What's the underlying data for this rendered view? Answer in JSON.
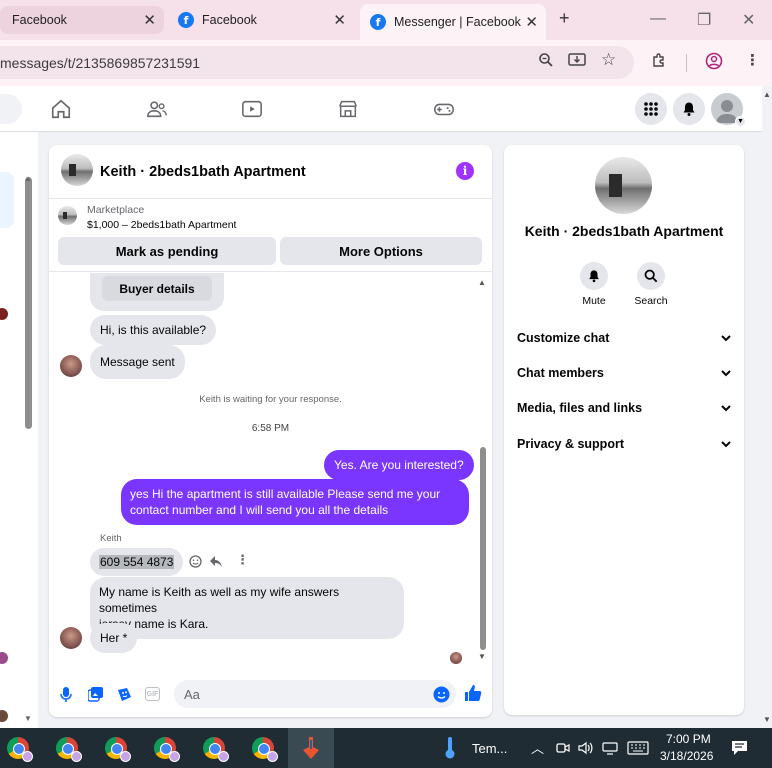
{
  "browser": {
    "tabs": [
      {
        "label": "Facebook",
        "active": false
      },
      {
        "label": "Facebook",
        "active": false
      },
      {
        "label": "Messenger | Facebook",
        "active": true
      }
    ],
    "url": "messages/t/2135869857231591"
  },
  "chat": {
    "title": "Keith · 2beds1bath Apartment",
    "marketplace_label": "Marketplace",
    "marketplace_price": "$1,000 – 2beds1bath Apartment",
    "mark_pending": "Mark as pending",
    "more_options": "More Options",
    "buyer_details": "Buyer details",
    "messages": {
      "in1": "Hi, is this available?",
      "in2": "Message sent",
      "waiting": "Keith is waiting for your response.",
      "time": "6:58 PM",
      "out1": "Yes. Are you interested?",
      "out2_line1": "yes Hi the apartment is still available Please send me your",
      "out2_line2": "contact number and I will send you all the details",
      "sender": "Keith",
      "in3": "609 554 4873",
      "in4_line1": "My name is Keith as well as my wife answers sometimes",
      "in4_line2": "jersey name is Kara.",
      "in5": "Her *"
    },
    "composer_placeholder": "Aa"
  },
  "info": {
    "name": "Keith · 2beds1bath Apartment",
    "mute": "Mute",
    "search": "Search",
    "sections": [
      "Customize chat",
      "Chat members",
      "Media, files and links",
      "Privacy & support"
    ]
  },
  "taskbar": {
    "weather": "Tem...",
    "time": "7:00 PM",
    "date": "3/18/2026"
  },
  "colors": {
    "accent": "#7a35ff",
    "fb_blue": "#0866ff"
  }
}
